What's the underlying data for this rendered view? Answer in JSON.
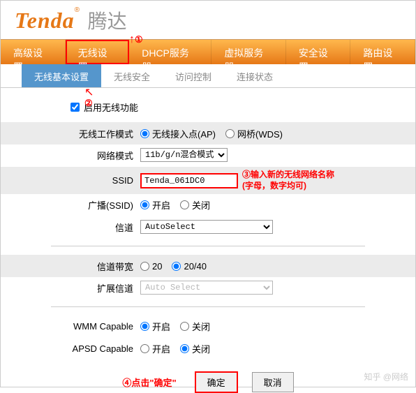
{
  "logo": {
    "brand": "Tenda",
    "reg": "®",
    "cn": "腾达"
  },
  "main_tabs": [
    "高级设置",
    "无线设置",
    "DHCP服务器",
    "虚拟服务器",
    "安全设置",
    "路由设置"
  ],
  "sub_tabs": [
    "无线基本设置",
    "无线安全",
    "访问控制",
    "连接状态"
  ],
  "enable_wireless": "启用无线功能",
  "labels": {
    "work_mode": "无线工作模式",
    "net_mode": "网络模式",
    "ssid": "SSID",
    "broadcast": "广播(SSID)",
    "channel": "信道",
    "bandwidth": "信道带宽",
    "ext_channel": "扩展信道",
    "wmm": "WMM Capable",
    "apsd": "APSD Capable"
  },
  "radio": {
    "ap": "无线接入点(AP)",
    "wds": "网桥(WDS)",
    "on": "开启",
    "off": "关闭",
    "bw20": "20",
    "bw2040": "20/40"
  },
  "selects": {
    "net_mode": "11b/g/n混合模式",
    "channel": "AutoSelect",
    "ext_channel": "Auto Select"
  },
  "ssid_value": "Tenda_061DC0",
  "buttons": {
    "ok": "确定",
    "cancel": "取消"
  },
  "annotations": {
    "a1": "①",
    "a1_arrow": "↑",
    "a2": "②",
    "a2_arrow": "↖",
    "a3": "③输入新的无线网络名称",
    "a3b": "(字母，数字均可)",
    "a4": "④点击\"确定\""
  },
  "watermark": "知乎 @网络"
}
